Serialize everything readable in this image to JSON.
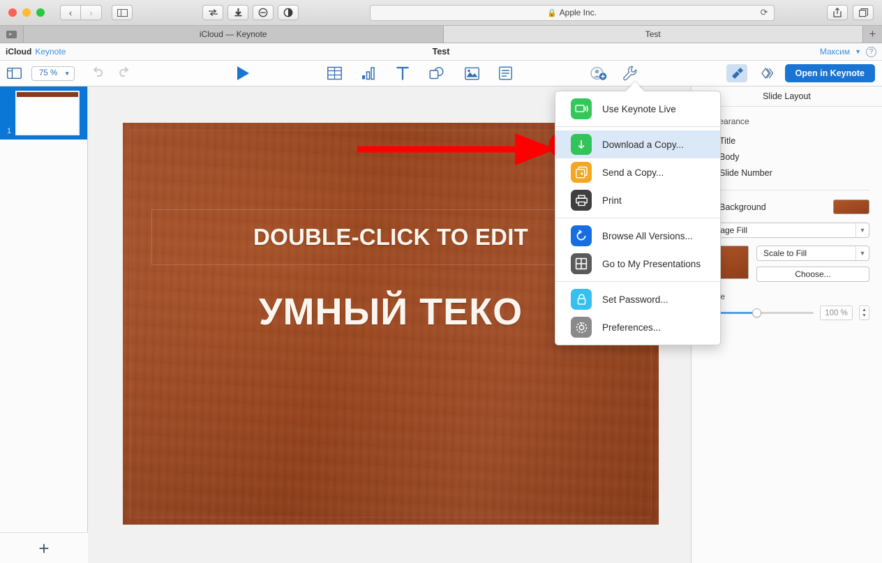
{
  "browser": {
    "address": {
      "text": "Apple Inc.",
      "lock_icon": "lock-icon",
      "reload_icon": "reload-icon"
    },
    "tabs": [
      {
        "label": "iCloud — Keynote",
        "active": false
      },
      {
        "label": "Test",
        "active": true
      }
    ],
    "new_tab_label": "+",
    "back_label": "‹",
    "forward_label": "›"
  },
  "keynote_header": {
    "breadcrumb_icloud": "iCloud",
    "breadcrumb_app": "Keynote",
    "document_title": "Test",
    "user_name": "Максим",
    "help_label": "?"
  },
  "toolbar": {
    "zoom_value": "75 %",
    "open_in_keynote_label": "Open in Keynote",
    "icons": [
      "view-options-icon",
      "undo-icon",
      "redo-icon",
      "play-icon",
      "table-icon",
      "chart-icon",
      "text-icon",
      "shape-icon",
      "media-icon",
      "comment-icon",
      "collaborate-icon",
      "tools-icon",
      "format-icon",
      "animate-icon"
    ]
  },
  "navigator": {
    "slide_number": "1",
    "add_slide_label": "+"
  },
  "slide": {
    "title_text": "DOUBLE-CLICK TO EDIT",
    "body_text": "УМНЫЙ ТЕКО",
    "background_color": "#a04a20"
  },
  "annotations": {
    "arrow_color": "#ff0000",
    "ellipse_color": "#ff0000"
  },
  "menu": {
    "groups": [
      {
        "items": [
          {
            "label": "Use Keynote Live",
            "icon": "keynote-live-icon",
            "color": "#34c85a",
            "glyph": "live",
            "highlighted": false
          }
        ]
      },
      {
        "items": [
          {
            "label": "Download a Copy...",
            "icon": "download-icon",
            "color": "#32c45a",
            "glyph": "download",
            "highlighted": true
          },
          {
            "label": "Send a Copy...",
            "icon": "send-copy-icon",
            "color": "#f5a623",
            "glyph": "copies",
            "highlighted": false
          },
          {
            "label": "Print",
            "icon": "print-icon",
            "color": "#3f3f3f",
            "glyph": "printer",
            "highlighted": false
          }
        ]
      },
      {
        "items": [
          {
            "label": "Browse All Versions...",
            "icon": "versions-icon",
            "color": "#186ee0",
            "glyph": "history",
            "highlighted": false
          },
          {
            "label": "Go to My Presentations",
            "icon": "presentations-icon",
            "color": "#5a5a5a",
            "glyph": "grid",
            "highlighted": false
          }
        ]
      },
      {
        "items": [
          {
            "label": "Set Password...",
            "icon": "password-icon",
            "color": "#35c0f0",
            "glyph": "lock",
            "highlighted": false
          },
          {
            "label": "Preferences...",
            "icon": "preferences-icon",
            "color": "#8a8a8a",
            "glyph": "gear",
            "highlighted": false
          }
        ]
      }
    ]
  },
  "inspector": {
    "title": "Slide Layout",
    "appearance_label": "Appearance",
    "checkboxes": [
      {
        "label": "Title",
        "checked": true
      },
      {
        "label": "Body",
        "checked": true
      },
      {
        "label": "Slide Number",
        "checked": false
      }
    ],
    "background_label": "Background",
    "background_checked": true,
    "fill_type": "Image Fill",
    "scale_mode": "Scale to Fill",
    "choose_label": "Choose...",
    "scale_label": "Scale",
    "scale_value": "100 %"
  }
}
